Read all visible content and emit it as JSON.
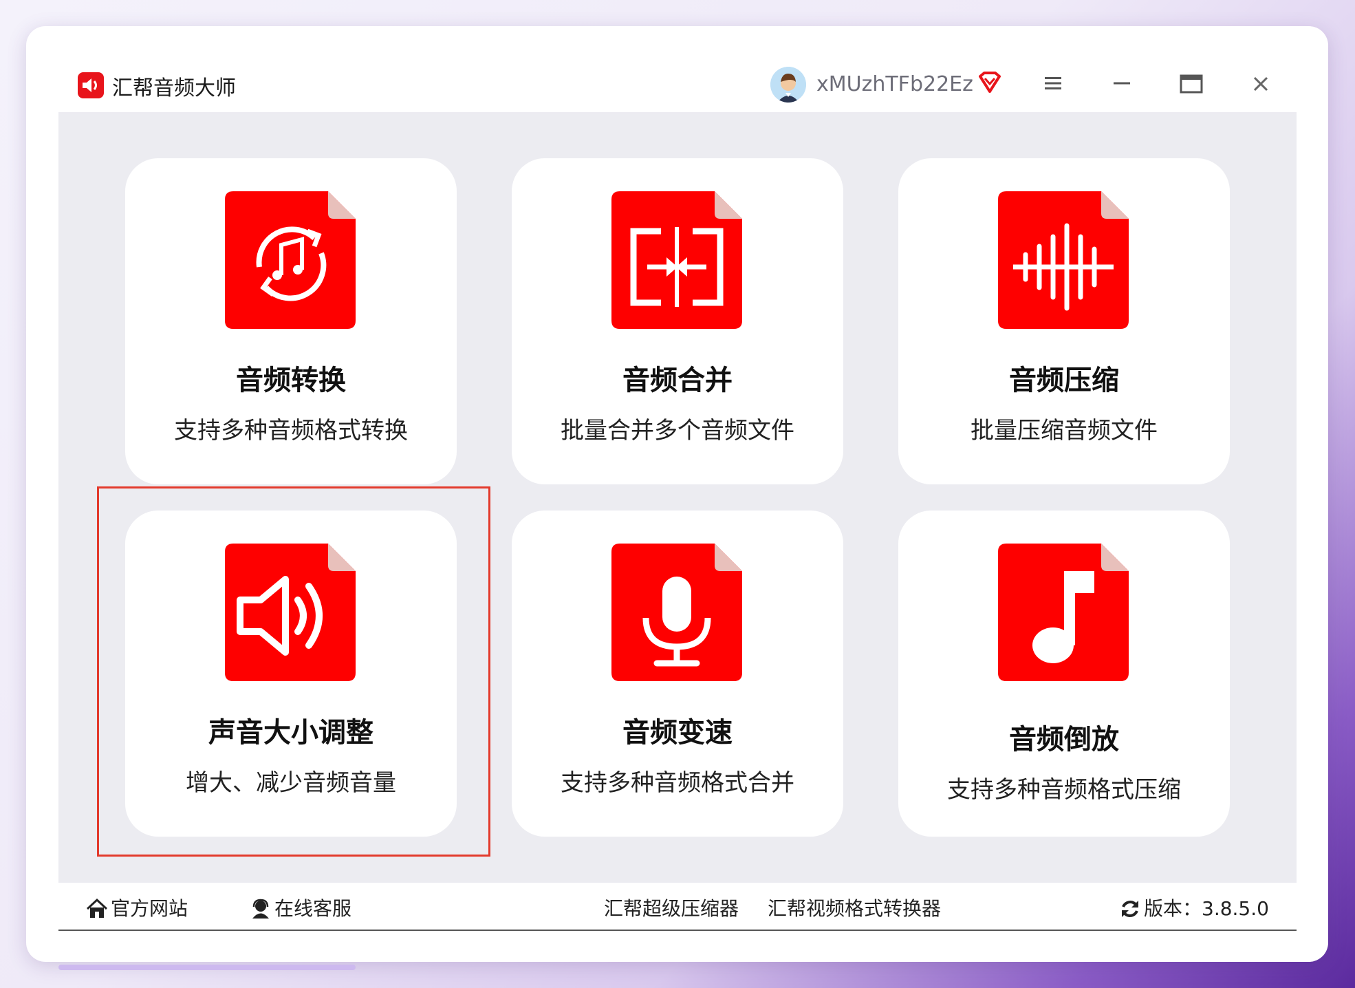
{
  "app": {
    "title": "汇帮音频大师"
  },
  "user": {
    "name": "xMUzhTFb22Ez"
  },
  "icons": {
    "logo": "speaker-logo-icon",
    "vip": "vip-diamond-icon",
    "menu": "hamburger-menu-icon",
    "minimize": "minimize-icon",
    "maximize": "maximize-icon",
    "close": "close-icon"
  },
  "colors": {
    "accent": "#fe0000",
    "highlight": "#e33a2c",
    "page_corner": "#e8c0bb"
  },
  "cards": [
    {
      "title": "音频转换",
      "desc": "支持多种音频格式转换",
      "icon": "audio-convert-icon"
    },
    {
      "title": "音频合并",
      "desc": "批量合并多个音频文件",
      "icon": "audio-merge-icon"
    },
    {
      "title": "音频压缩",
      "desc": "批量压缩音频文件",
      "icon": "audio-compress-icon"
    },
    {
      "title": "声音大小调整",
      "desc": "增大、减少音频音量",
      "icon": "volume-adjust-icon"
    },
    {
      "title": "音频变速",
      "desc": "支持多种音频格式合并",
      "icon": "microphone-icon"
    },
    {
      "title": "音频倒放",
      "desc": "支持多种音频格式压缩",
      "icon": "music-note-icon"
    }
  ],
  "footer": {
    "website": "官方网站",
    "support": "在线客服",
    "link1": "汇帮超级压缩器",
    "link2": "汇帮视频格式转换器",
    "version": "版本：3.8.5.0"
  }
}
